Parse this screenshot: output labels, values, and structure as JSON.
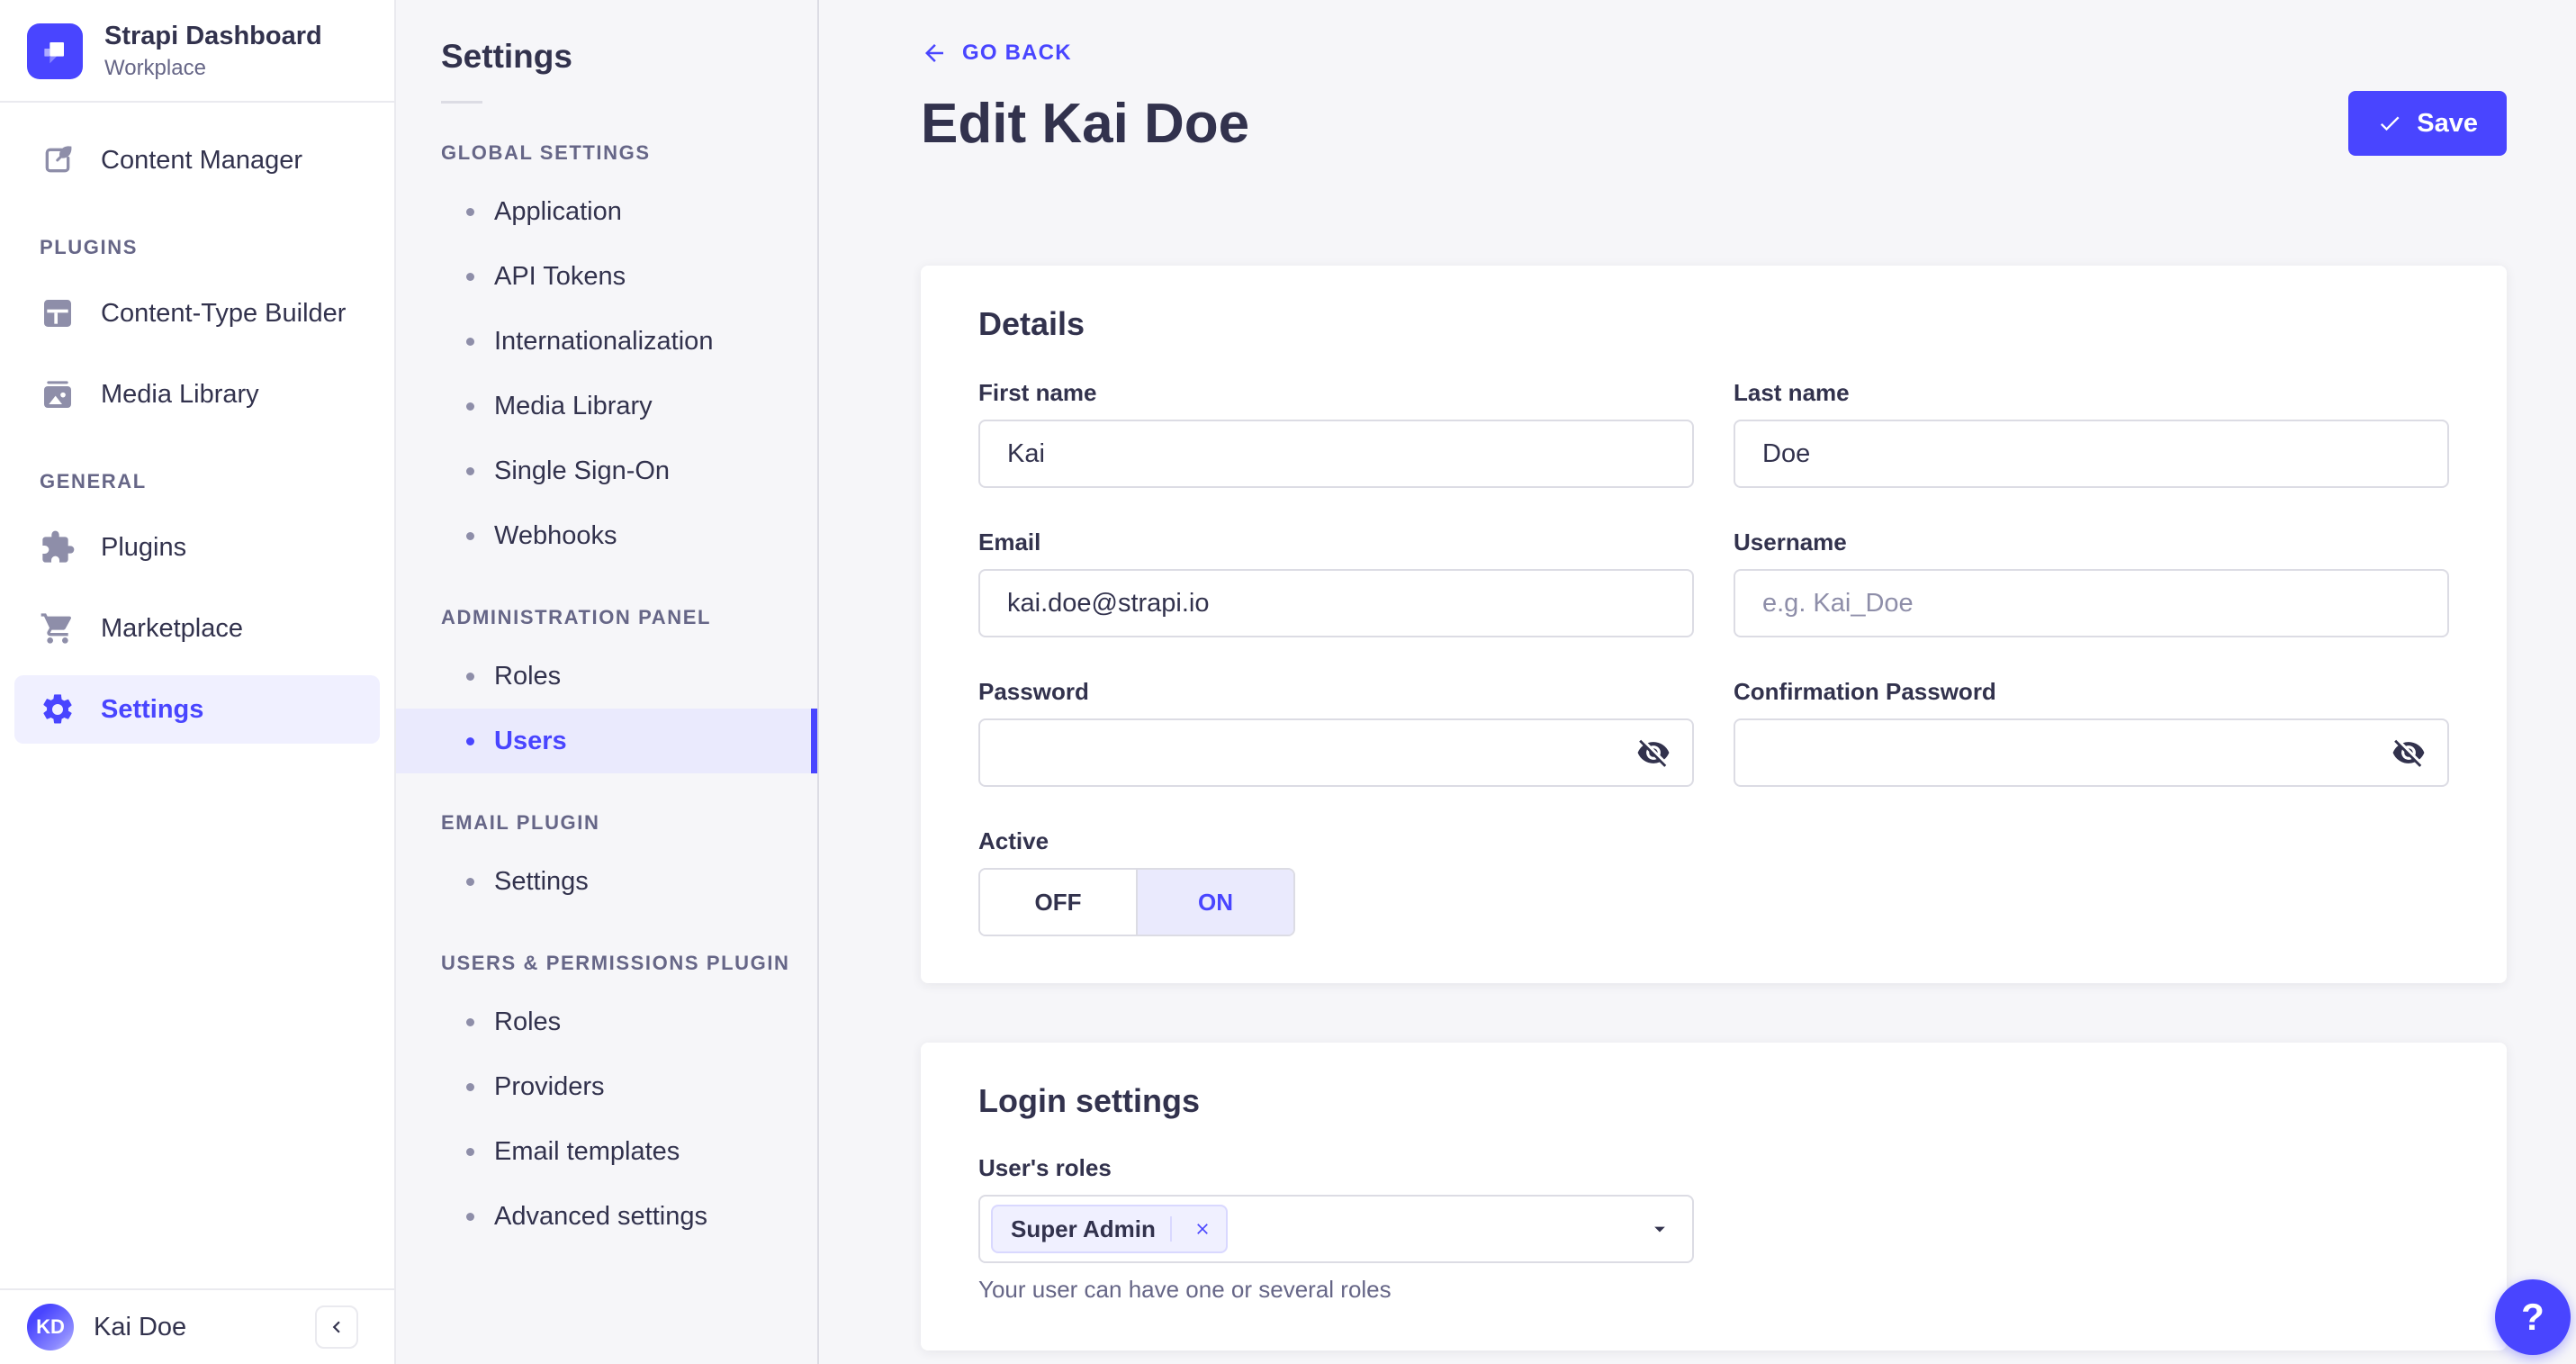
{
  "colors": {
    "accent": "#4945ff",
    "accent_light_bg": "#eaeafd",
    "accent_lighter_bg": "#f0f0ff",
    "text": "#32324d",
    "muted_text": "#666687",
    "icon_gray": "#8e8ea9",
    "input_border": "#dcdce4",
    "divider": "#eaeaef",
    "page_bg": "#f6f6f9"
  },
  "brand": {
    "title": "Strapi Dashboard",
    "subtitle": "Workplace",
    "logo_icon": "strapi-logo-icon"
  },
  "main_nav": {
    "content_manager": {
      "label": "Content Manager",
      "icon": "pen-icon"
    },
    "sections": [
      {
        "header": "PLUGINS",
        "items": [
          {
            "label": "Content-Type Builder",
            "icon": "layout-icon"
          },
          {
            "label": "Media Library",
            "icon": "picture-icon"
          }
        ]
      },
      {
        "header": "GENERAL",
        "items": [
          {
            "label": "Plugins",
            "icon": "puzzle-icon"
          },
          {
            "label": "Marketplace",
            "icon": "cart-icon"
          },
          {
            "label": "Settings",
            "icon": "gear-icon",
            "active": true
          }
        ]
      }
    ],
    "footer": {
      "initials": "KD",
      "name": "Kai Doe",
      "collapse_icon": "chevron-left-icon"
    }
  },
  "sub_nav": {
    "title": "Settings",
    "sections": [
      {
        "header": "GLOBAL SETTINGS",
        "items": [
          {
            "label": "Application"
          },
          {
            "label": "API Tokens"
          },
          {
            "label": "Internationalization"
          },
          {
            "label": "Media Library"
          },
          {
            "label": "Single Sign-On"
          },
          {
            "label": "Webhooks"
          }
        ]
      },
      {
        "header": "ADMINISTRATION PANEL",
        "items": [
          {
            "label": "Roles"
          },
          {
            "label": "Users",
            "active": true
          }
        ]
      },
      {
        "header": "EMAIL PLUGIN",
        "items": [
          {
            "label": "Settings"
          }
        ]
      },
      {
        "header": "USERS & PERMISSIONS PLUGIN",
        "items": [
          {
            "label": "Roles"
          },
          {
            "label": "Providers"
          },
          {
            "label": "Email templates"
          },
          {
            "label": "Advanced settings"
          }
        ]
      }
    ]
  },
  "header": {
    "back_label": "GO BACK",
    "title": "Edit Kai Doe",
    "save_label": "Save",
    "save_icon": "check-icon",
    "back_icon": "arrow-left-icon"
  },
  "details": {
    "title": "Details",
    "first_name": {
      "label": "First name",
      "value": "Kai"
    },
    "last_name": {
      "label": "Last name",
      "value": "Doe"
    },
    "email": {
      "label": "Email",
      "value": "kai.doe@strapi.io"
    },
    "username": {
      "label": "Username",
      "value": "",
      "placeholder": "e.g. Kai_Doe"
    },
    "password": {
      "label": "Password",
      "value": "",
      "icon": "eye-off-icon"
    },
    "confirm_password": {
      "label": "Confirmation Password",
      "value": "",
      "icon": "eye-off-icon"
    },
    "active": {
      "label": "Active",
      "off_label": "OFF",
      "on_label": "ON",
      "value": "ON"
    }
  },
  "login": {
    "title": "Login settings",
    "roles_label": "User's roles",
    "role_tag": "Super Admin",
    "remove_icon": "x-icon",
    "dropdown_icon": "caret-down-icon",
    "helper": "Your user can have one or several roles"
  },
  "help": {
    "label": "?"
  }
}
